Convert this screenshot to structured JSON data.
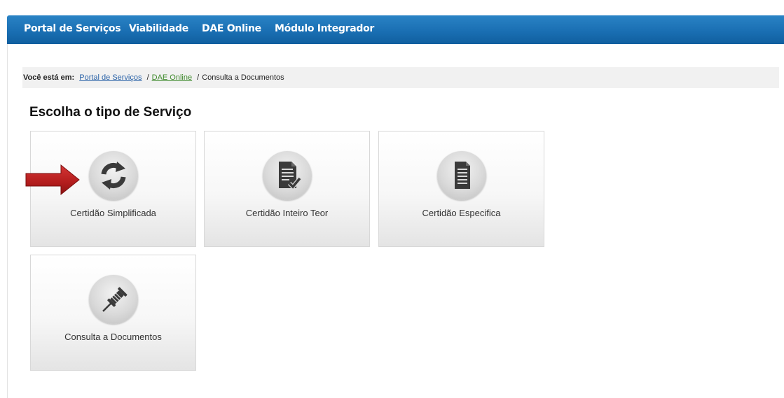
{
  "topnav": {
    "items": [
      {
        "label": "Portal de Serviços"
      },
      {
        "label": "Viabilidade"
      },
      {
        "label": "DAE Online"
      },
      {
        "label": "Módulo Integrador"
      }
    ]
  },
  "breadcrumb": {
    "prefix": "Você está em:",
    "links": [
      "Portal de Serviços",
      "DAE Online"
    ],
    "separator": "/",
    "current": "Consulta a Documentos"
  },
  "page": {
    "title": "Escolha o tipo de Serviço"
  },
  "tiles": [
    {
      "label": "Certidão Simplificada",
      "icon": "sync-arrows-icon"
    },
    {
      "label": "Certidão Inteiro Teor",
      "icon": "document-check-icon"
    },
    {
      "label": "Certidão Especifica",
      "icon": "document-icon"
    },
    {
      "label": "Consulta a Documentos",
      "icon": "pushpin-icon"
    }
  ],
  "colors": {
    "nav_background": "#1a6fb3",
    "arrow_red": "#b31d1d",
    "icon_dark": "#3a3a3a"
  }
}
